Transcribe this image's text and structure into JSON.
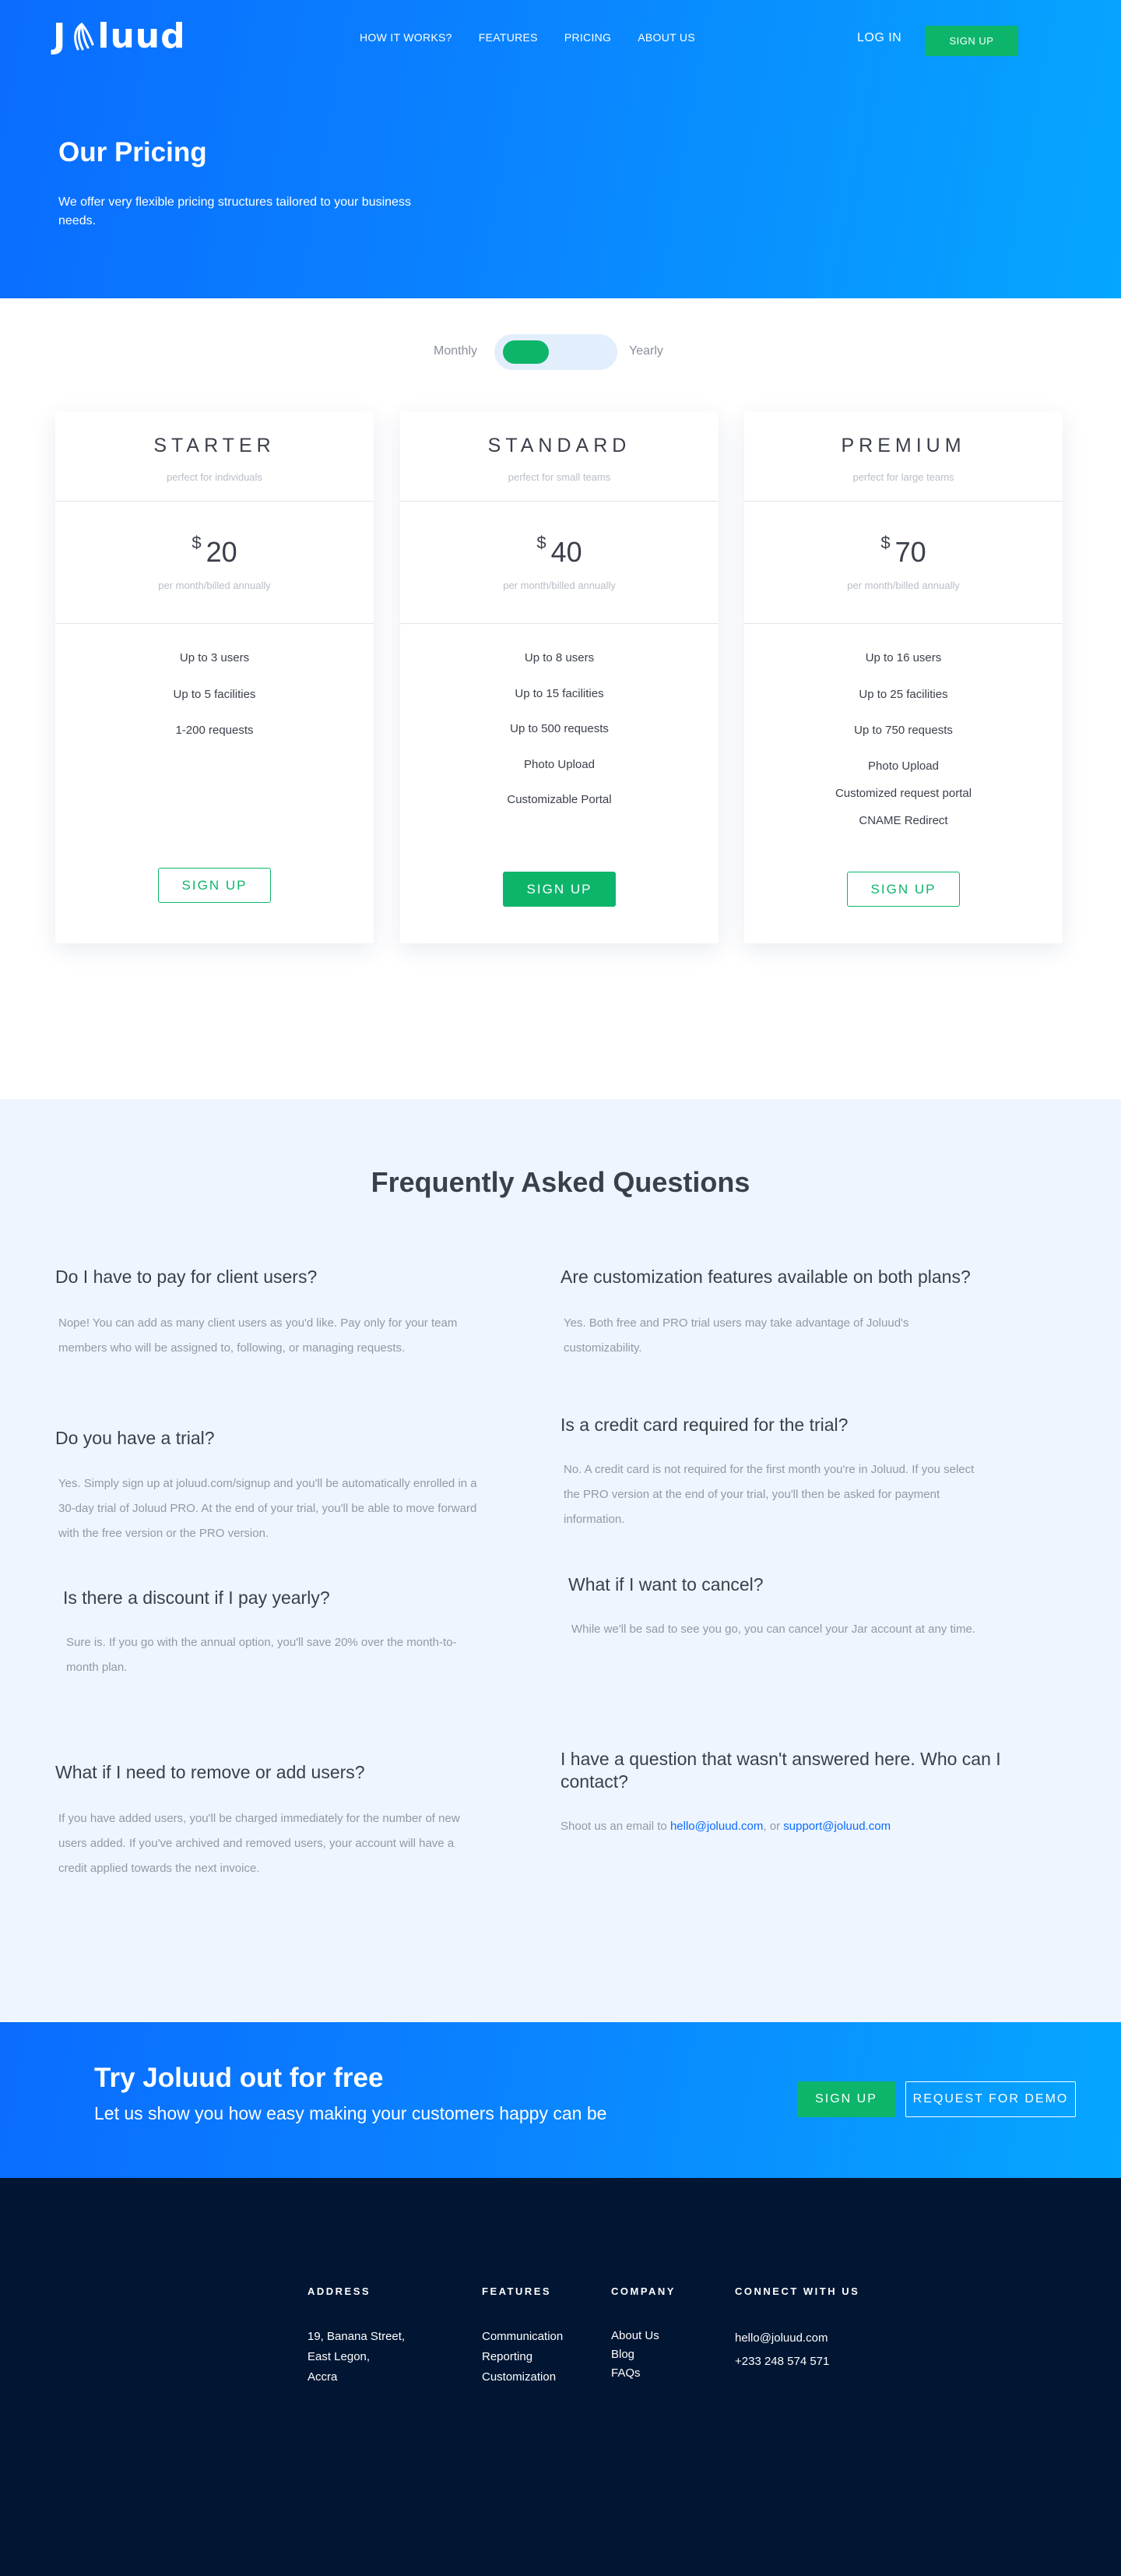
{
  "brand": {
    "name": "Joluud"
  },
  "nav": {
    "items": [
      "HOW IT WORKS?",
      "FEATURES",
      "PRICING",
      "ABOUT US"
    ],
    "login": "LOG IN",
    "signup": "SIGN UP"
  },
  "hero": {
    "title": "Our Pricing",
    "subtitle": "We offer very flexible pricing structures tailored to your business needs."
  },
  "billing": {
    "monthly": "Monthly",
    "yearly": "Yearly",
    "selected": "Monthly"
  },
  "plans": [
    {
      "name": "STARTER",
      "tagline": "perfect for individuals",
      "currency": "$",
      "price": "20",
      "period": "per month/billed annually",
      "features": [
        "Up to 3 users",
        "Up to 5 facilities",
        "1-200 requests"
      ],
      "cta": "SIGN UP"
    },
    {
      "name": "STANDARD",
      "tagline": "perfect for small teams",
      "currency": "$",
      "price": "40",
      "period": "per month/billed annually",
      "features": [
        "Up to 8 users",
        "Up to 15 facilities",
        "Up to 500 requests",
        "Photo Upload",
        "Customizable Portal"
      ],
      "cta": "SIGN UP"
    },
    {
      "name": "PREMIUM",
      "tagline": "perfect for large teams",
      "currency": "$",
      "price": "70",
      "period": "per month/billed annually",
      "features": [
        "Up to 16 users",
        "Up to 25 facilities",
        "Up to 750 requests",
        "Photo Upload",
        "Customized request portal",
        "CNAME Redirect"
      ],
      "cta": "SIGN UP"
    }
  ],
  "faq": {
    "title": "Frequently Asked Questions",
    "items": [
      {
        "q": "Do I have to pay for client users?",
        "a": "Nope! You can add as many client users as you'd like. Pay only for your team members who will be assigned to, following, or managing requests."
      },
      {
        "q": "Are customization features available on both plans?",
        "a": "Yes. Both free and PRO trial users may take advantage of Joluud's customizability."
      },
      {
        "q": "Do you have a trial?",
        "a": "Yes. Simply sign up at joluud.com/signup and you'll be automatically enrolled in a 30-day trial of Joluud PRO. At the end of your trial, you'll be able to move forward with the free version or the PRO version."
      },
      {
        "q": "Is a credit card required for the trial?",
        "a": "No. A credit card is not required for the first month you're in Joluud. If you select the PRO version at the end of your trial, you'll then be asked for payment information."
      },
      {
        "q": "Is there a discount if I pay yearly?",
        "a": "Sure is. If you go with the annual option, you'll save 20% over the month-to-month plan."
      },
      {
        "q": "What if I want to cancel?",
        "a": "While we'll be sad to see you go, you can cancel your Jar account at any time."
      },
      {
        "q": "What if I need to remove or add users?",
        "a": "If you have added users, you'll be charged immediately for the number of new users added. If you've archived and removed users, your account will have a credit applied towards the next invoice."
      },
      {
        "q": "I have a question that wasn't answered here. Who can I contact?",
        "a_prefix": "Shoot us an email to",
        "email1": "hello@joluud.com",
        "a_mid": ", or",
        "email2": "support@joluud.com"
      }
    ]
  },
  "cta": {
    "title": "Try Joluud out for free",
    "subtitle": "Let us show you how easy making your customers happy can be",
    "signup": "SIGN UP",
    "demo": "REQUEST FOR DEMO"
  },
  "footer": {
    "address": {
      "heading": "ADDRESS",
      "lines": [
        "19, Banana Street,",
        "East Legon,",
        "Accra"
      ]
    },
    "features": {
      "heading": "FEATURES",
      "links": [
        "Communication",
        "Reporting",
        "Customization"
      ]
    },
    "company": {
      "heading": "COMPANY",
      "links": [
        "About Us",
        "Blog",
        "FAQs"
      ]
    },
    "connect": {
      "heading": "CONNECT WITH US",
      "email": "hello@joluud.com",
      "phone": "+233 248 574 571"
    }
  },
  "colors": {
    "primary": "#0a6cff",
    "accent": "#05a6ff",
    "green": "#0db56a",
    "footer": "#011633",
    "faq_bg": "#eef5fe"
  }
}
